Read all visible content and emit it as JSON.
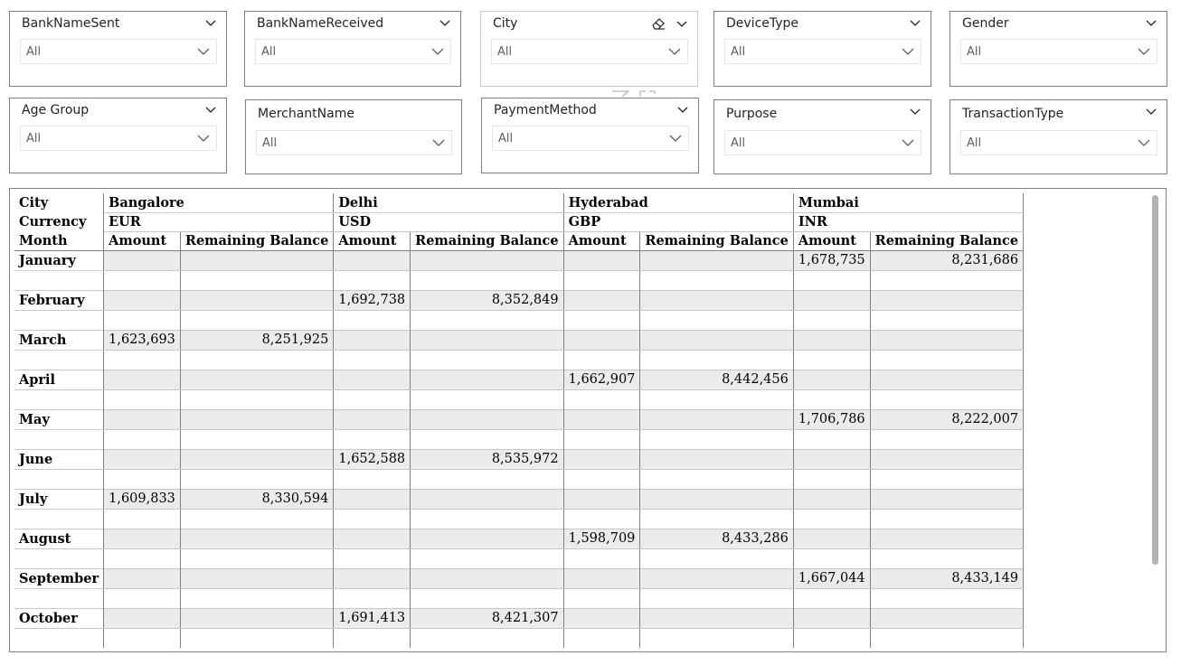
{
  "slicers": {
    "row1": [
      {
        "title": "BankNameSent",
        "value": "All"
      },
      {
        "title": "BankNameReceived",
        "value": "All"
      },
      {
        "title": "City",
        "value": "All"
      },
      {
        "title": "DeviceType",
        "value": "All"
      },
      {
        "title": "Gender",
        "value": "All"
      }
    ],
    "row2": [
      {
        "title": "Age Group",
        "value": "All"
      },
      {
        "title": "MerchantName",
        "value": "All"
      },
      {
        "title": "PaymentMethod",
        "value": "All"
      },
      {
        "title": "Purpose",
        "value": "All"
      },
      {
        "title": "TransactionType",
        "value": "All"
      }
    ]
  },
  "matrix": {
    "row_headers": {
      "city": "City",
      "currency": "Currency",
      "month": "Month"
    },
    "cities": [
      {
        "name": "Bangalore",
        "currency": "EUR"
      },
      {
        "name": "Delhi",
        "currency": "USD"
      },
      {
        "name": "Hyderabad",
        "currency": "GBP"
      },
      {
        "name": "Mumbai",
        "currency": "INR"
      }
    ],
    "measures": {
      "amount": "Amount",
      "balance": "Remaining Balance"
    },
    "rows": [
      {
        "month": "January",
        "cells": [
          "",
          "",
          "",
          "",
          "",
          "",
          "1,678,735",
          "8,231,686"
        ]
      },
      {
        "month": "February",
        "cells": [
          "",
          "",
          "1,692,738",
          "8,352,849",
          "",
          "",
          "",
          ""
        ]
      },
      {
        "month": "March",
        "cells": [
          "1,623,693",
          "8,251,925",
          "",
          "",
          "",
          "",
          "",
          ""
        ]
      },
      {
        "month": "April",
        "cells": [
          "",
          "",
          "",
          "",
          "1,662,907",
          "8,442,456",
          "",
          ""
        ]
      },
      {
        "month": "May",
        "cells": [
          "",
          "",
          "",
          "",
          "",
          "",
          "1,706,786",
          "8,222,007"
        ]
      },
      {
        "month": "June",
        "cells": [
          "",
          "",
          "1,652,588",
          "8,535,972",
          "",
          "",
          "",
          ""
        ]
      },
      {
        "month": "July",
        "cells": [
          "1,609,833",
          "8,330,594",
          "",
          "",
          "",
          "",
          "",
          ""
        ]
      },
      {
        "month": "August",
        "cells": [
          "",
          "",
          "",
          "",
          "1,598,709",
          "8,433,286",
          "",
          ""
        ]
      },
      {
        "month": "September",
        "cells": [
          "",
          "",
          "",
          "",
          "",
          "",
          "1,667,044",
          "8,433,149"
        ]
      },
      {
        "month": "October",
        "cells": [
          "",
          "",
          "1,691,413",
          "8,421,307",
          "",
          "",
          "",
          ""
        ]
      }
    ]
  }
}
